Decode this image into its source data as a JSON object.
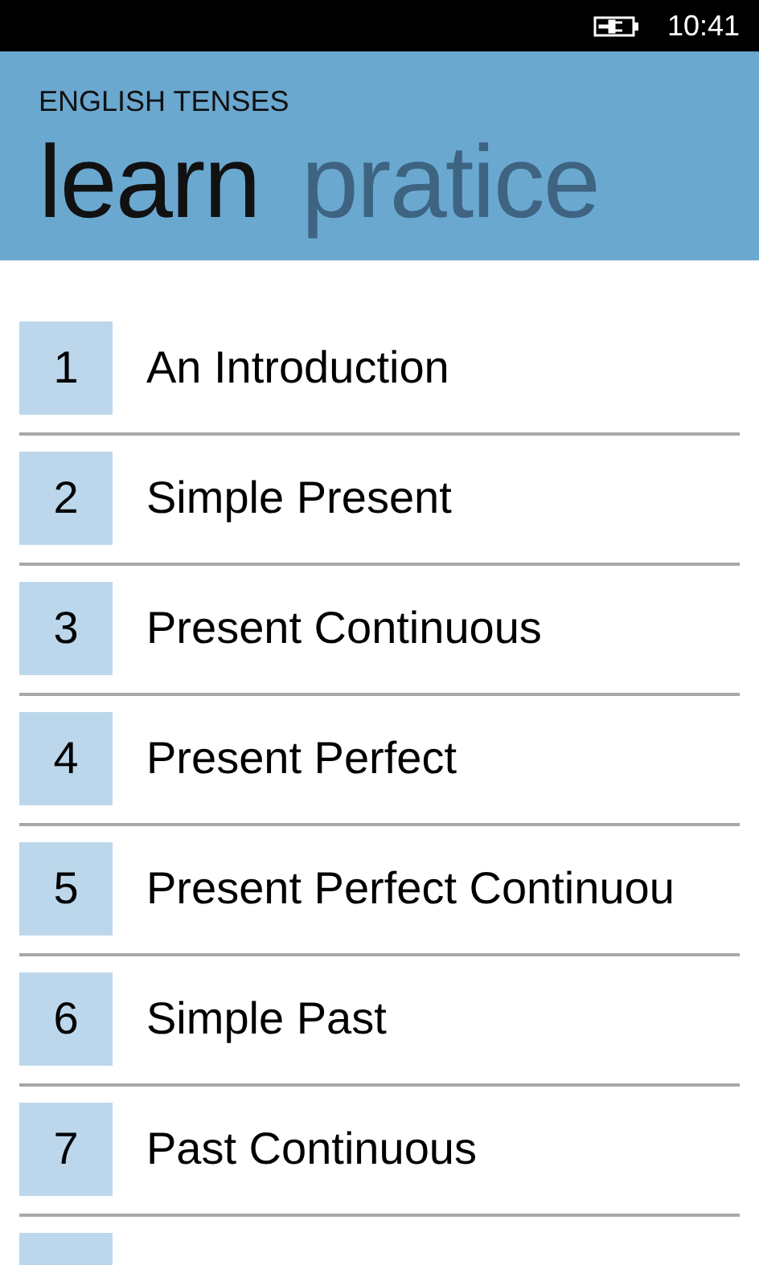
{
  "status_bar": {
    "time": "10:41"
  },
  "app_title": "ENGLISH TENSES",
  "tabs": [
    {
      "label": "learn",
      "selected": true
    },
    {
      "label": "pratice",
      "selected": false
    }
  ],
  "lessons": [
    {
      "number": "1",
      "title": "An Introduction"
    },
    {
      "number": "2",
      "title": "Simple Present"
    },
    {
      "number": "3",
      "title": "Present Continuous"
    },
    {
      "number": "4",
      "title": "Present Perfect"
    },
    {
      "number": "5",
      "title": "Present Perfect Continuou"
    },
    {
      "number": "6",
      "title": "Simple Past"
    },
    {
      "number": "7",
      "title": "Past Continuous"
    }
  ],
  "more_below": true
}
